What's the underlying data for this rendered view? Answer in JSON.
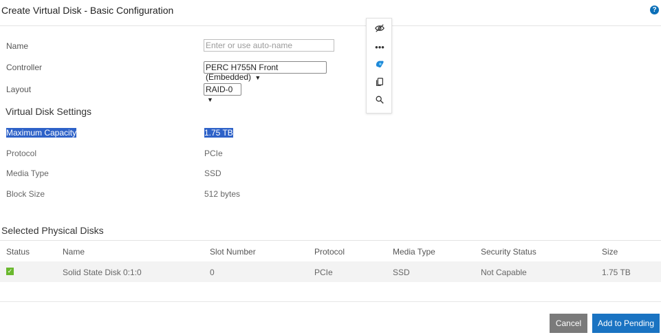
{
  "dialog": {
    "title": "Create Virtual Disk - Basic Configuration",
    "help_icon": "?"
  },
  "form": {
    "name_label": "Name",
    "name_placeholder": "Enter or use auto-name",
    "name_value": "",
    "controller_label": "Controller",
    "controller_value": "PERC H755N Front (Embedded)",
    "layout_label": "Layout",
    "layout_value": "RAID-0"
  },
  "settings": {
    "title": "Virtual Disk Settings",
    "max_capacity_label": "Maximum Capacity",
    "max_capacity_value": "1.75 TB",
    "protocol_label": "Protocol",
    "protocol_value": "PCIe",
    "media_type_label": "Media Type",
    "media_type_value": "SSD",
    "block_size_label": "Block Size",
    "block_size_value": "512 bytes"
  },
  "selected_disks": {
    "title": "Selected Physical Disks",
    "columns": [
      "Status",
      "Name",
      "Slot Number",
      "Protocol",
      "Media Type",
      "Security Status",
      "Size"
    ],
    "rows": [
      {
        "status": "ok",
        "name": "Solid State Disk 0:1:0",
        "slot": "0",
        "protocol": "PCIe",
        "media_type": "SSD",
        "security_status": "Not Capable",
        "size": "1.75 TB"
      }
    ]
  },
  "floating_toolbar": {
    "icons": [
      "eye-off-icon",
      "more-icon",
      "copilot-icon",
      "copy-icon",
      "search-icon"
    ]
  },
  "footer": {
    "cancel_label": "Cancel",
    "add_label": "Add to Pending"
  },
  "colors": {
    "primary": "#1a73c2",
    "cancel": "#7a7a7a",
    "selection": "#2e62c8",
    "status_ok": "#6ab82e"
  }
}
